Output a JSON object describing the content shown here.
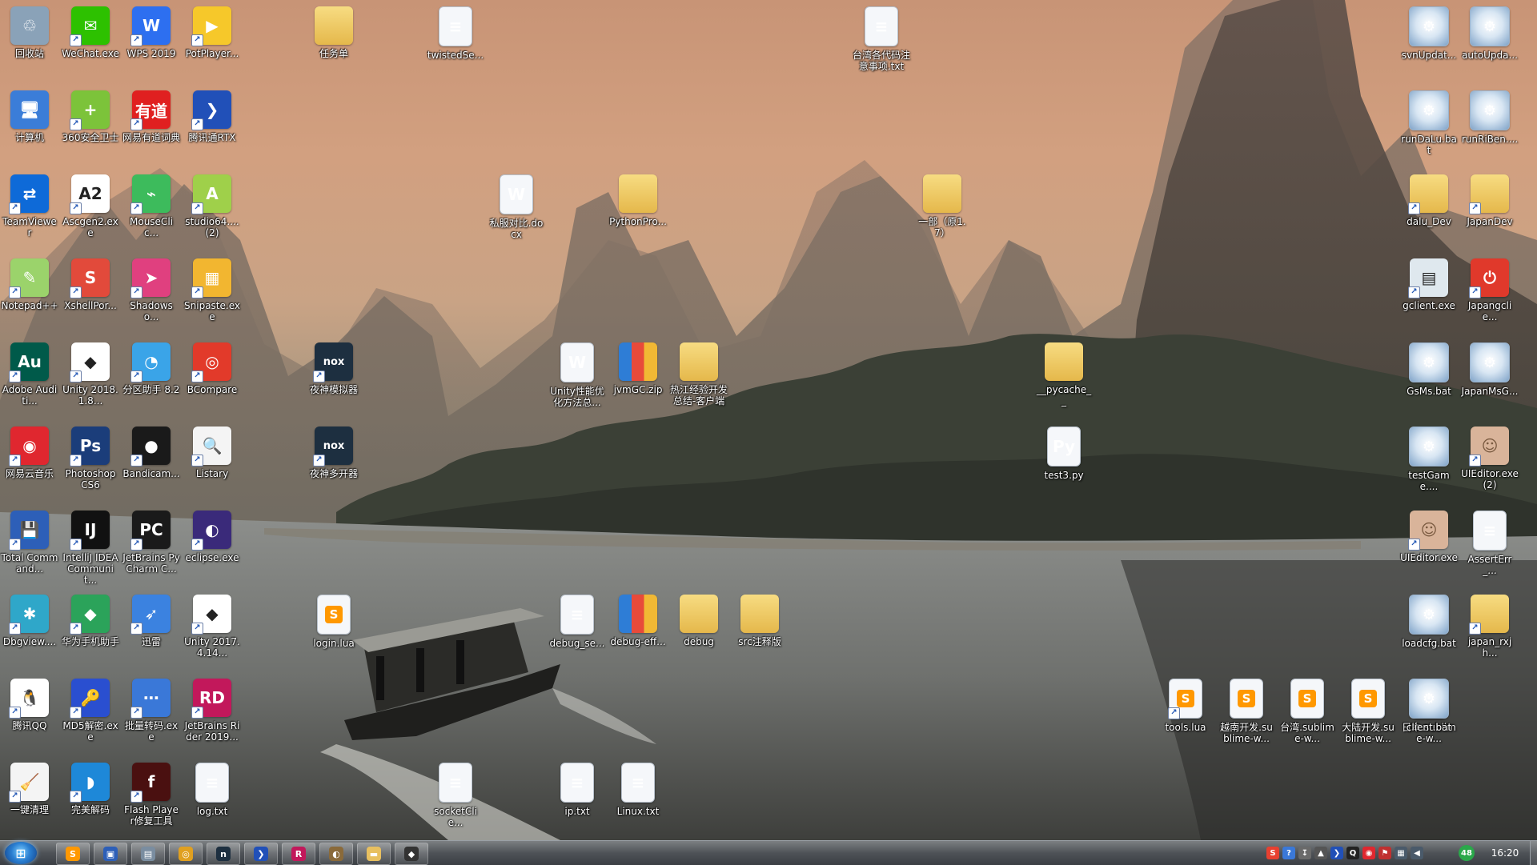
{
  "desktop": {
    "icons": [
      {
        "label": "回收站",
        "kind": "app",
        "color": "#8aa2b8",
        "glyph": "♲",
        "shortcut": false
      },
      {
        "label": "WeChat.exe",
        "kind": "app",
        "color": "#2dc100",
        "glyph": "✉",
        "shortcut": true
      },
      {
        "label": "WPS 2019",
        "kind": "app",
        "color": "#2d6ff0",
        "glyph": "W",
        "shortcut": true
      },
      {
        "label": "PotPlayer...",
        "kind": "app",
        "color": "#f6c82a",
        "glyph": "▶",
        "shortcut": true
      },
      {
        "label": "任务单",
        "kind": "folder",
        "color": "#f0cc6a",
        "glyph": "",
        "shortcut": false
      },
      {
        "label": "twistedSe...",
        "kind": "file",
        "color": "#ffffff",
        "glyph": "≡",
        "shortcut": false
      },
      {
        "label": "台湾各代码注意事项.txt",
        "kind": "file",
        "color": "#ffffff",
        "glyph": "≡",
        "shortcut": false
      },
      {
        "label": "svnUpdat...",
        "kind": "bat",
        "color": "#cfe0f0",
        "glyph": "⚙",
        "shortcut": false
      },
      {
        "label": "autoUpda...",
        "kind": "bat",
        "color": "#cfe0f0",
        "glyph": "⚙",
        "shortcut": false
      },
      {
        "label": "计算机",
        "kind": "app",
        "color": "#3b7dd8",
        "glyph": "🖥",
        "shortcut": false
      },
      {
        "label": "360安全卫士",
        "kind": "app",
        "color": "#7cc33a",
        "glyph": "+",
        "shortcut": true
      },
      {
        "label": "网易有道词典",
        "kind": "app",
        "color": "#e02020",
        "glyph": "有道",
        "shortcut": true
      },
      {
        "label": "腾讯通RTX",
        "kind": "app",
        "color": "#2150b8",
        "glyph": "❯",
        "shortcut": true
      },
      {
        "label": "runDaLu.bat",
        "kind": "bat",
        "color": "#cfe0f0",
        "glyph": "⚙",
        "shortcut": false
      },
      {
        "label": "runRiBen....",
        "kind": "bat",
        "color": "#cfe0f0",
        "glyph": "⚙",
        "shortcut": false
      },
      {
        "label": "TeamViewer",
        "kind": "app",
        "color": "#0e6ad8",
        "glyph": "⇄",
        "shortcut": true
      },
      {
        "label": "Ascgen2.exe",
        "kind": "app",
        "color": "#ffffff",
        "glyph": "A2",
        "shortcut": true
      },
      {
        "label": "MouseClic...",
        "kind": "app",
        "color": "#3dbb5c",
        "glyph": "⌁",
        "shortcut": true
      },
      {
        "label": "studio64.... (2)",
        "kind": "app",
        "color": "#9fd04a",
        "glyph": "A",
        "shortcut": true
      },
      {
        "label": "私服对比.docx",
        "kind": "file",
        "color": "#ffffff",
        "glyph": "W",
        "shortcut": false
      },
      {
        "label": "PythonPro...",
        "kind": "folder",
        "color": "#f0cc6a",
        "glyph": "",
        "shortcut": false
      },
      {
        "label": "一部（原1.7）",
        "kind": "folder",
        "color": "#f0cc6a",
        "glyph": "",
        "shortcut": false
      },
      {
        "label": "dalu_Dev",
        "kind": "folder",
        "color": "#f0cc6a",
        "glyph": "",
        "shortcut": true
      },
      {
        "label": "JapanDev",
        "kind": "folder",
        "color": "#f0cc6a",
        "glyph": "",
        "shortcut": true
      },
      {
        "label": "Notepad++",
        "kind": "app",
        "color": "#9bd36b",
        "glyph": "✎",
        "shortcut": true
      },
      {
        "label": "XshellPor...",
        "kind": "app",
        "color": "#e24a3b",
        "glyph": "S",
        "shortcut": true
      },
      {
        "label": "Shadowso...",
        "kind": "app",
        "color": "#e0407f",
        "glyph": "➤",
        "shortcut": true
      },
      {
        "label": "Snipaste.exe",
        "kind": "app",
        "color": "#f2b630",
        "glyph": "▦",
        "shortcut": true
      },
      {
        "label": "gclient.exe",
        "kind": "app",
        "color": "#dfe8ee",
        "glyph": "▤",
        "shortcut": true
      },
      {
        "label": "Japangclie...",
        "kind": "app",
        "color": "#e0392b",
        "glyph": "⏻",
        "shortcut": true
      },
      {
        "label": "Adobe Auditi...",
        "kind": "app",
        "color": "#005a4a",
        "glyph": "Au",
        "shortcut": true
      },
      {
        "label": "Unity 2018.1.8...",
        "kind": "app",
        "color": "#ffffff",
        "glyph": "◆",
        "shortcut": true
      },
      {
        "label": "分区助手 8.2",
        "kind": "app",
        "color": "#3aa4e8",
        "glyph": "◔",
        "shortcut": true
      },
      {
        "label": "BCompare",
        "kind": "app",
        "color": "#e23a2a",
        "glyph": "◎",
        "shortcut": true
      },
      {
        "label": "夜神模拟器",
        "kind": "app",
        "color": "#1d2f40",
        "glyph": "nox",
        "shortcut": true
      },
      {
        "label": "Unity性能优化方法总...",
        "kind": "file",
        "color": "#ffffff",
        "glyph": "W",
        "shortcut": false
      },
      {
        "label": "jvmGC.zip",
        "kind": "zip",
        "color": "#2e7dd6",
        "glyph": "",
        "shortcut": false
      },
      {
        "label": "热江经验开发总结-客户端",
        "kind": "folder",
        "color": "#f0cc6a",
        "glyph": "",
        "shortcut": false
      },
      {
        "label": "__pycache__",
        "kind": "folder",
        "color": "#f0cc6a",
        "glyph": "",
        "shortcut": false
      },
      {
        "label": "GsMs.bat",
        "kind": "bat",
        "color": "#cfe0f0",
        "glyph": "⚙",
        "shortcut": false
      },
      {
        "label": "JapanMsG...",
        "kind": "bat",
        "color": "#cfe0f0",
        "glyph": "⚙",
        "shortcut": false
      },
      {
        "label": "网易云音乐",
        "kind": "app",
        "color": "#e0272f",
        "glyph": "◉",
        "shortcut": true
      },
      {
        "label": "Photoshop CS6",
        "kind": "app",
        "color": "#1b3d7a",
        "glyph": "Ps",
        "shortcut": true
      },
      {
        "label": "Bandicam...",
        "kind": "app",
        "color": "#1a1a1a",
        "glyph": "●",
        "shortcut": true
      },
      {
        "label": "Listary",
        "kind": "app",
        "color": "#f4f4f4",
        "glyph": "🔍",
        "shortcut": true
      },
      {
        "label": "夜神多开器",
        "kind": "app",
        "color": "#1d2f40",
        "glyph": "nox",
        "shortcut": true
      },
      {
        "label": "test3.py",
        "kind": "file",
        "color": "#ffffff",
        "glyph": "Py",
        "shortcut": false
      },
      {
        "label": "testGame....",
        "kind": "bat",
        "color": "#cfe0f0",
        "glyph": "⚙",
        "shortcut": false
      },
      {
        "label": "UIEditor.exe (2)",
        "kind": "img",
        "color": "#d9b49a",
        "glyph": "☺",
        "shortcut": true
      },
      {
        "label": "Total Command...",
        "kind": "app",
        "color": "#2d5fb8",
        "glyph": "💾",
        "shortcut": true
      },
      {
        "label": "IntelliJ IDEA Communit...",
        "kind": "app",
        "color": "#111111",
        "glyph": "IJ",
        "shortcut": true
      },
      {
        "label": "JetBrains PyCharm C...",
        "kind": "app",
        "color": "#1a1a1a",
        "glyph": "PC",
        "shortcut": true
      },
      {
        "label": "eclipse.exe",
        "kind": "app",
        "color": "#3a2a7a",
        "glyph": "◐",
        "shortcut": true
      },
      {
        "label": "UIEditor.exe",
        "kind": "img",
        "color": "#d9b49a",
        "glyph": "☺",
        "shortcut": true
      },
      {
        "label": "AssertErr_...",
        "kind": "file",
        "color": "#ffffff",
        "glyph": "≡",
        "shortcut": false
      },
      {
        "label": "Dbgview....",
        "kind": "app",
        "color": "#2fa7c9",
        "glyph": "✱",
        "shortcut": true
      },
      {
        "label": "华为手机助手",
        "kind": "app",
        "color": "#2ba35a",
        "glyph": "◆",
        "shortcut": true
      },
      {
        "label": "迅雷",
        "kind": "app",
        "color": "#3b82e0",
        "glyph": "➶",
        "shortcut": true
      },
      {
        "label": "Unity 2017.4.14...",
        "kind": "app",
        "color": "#ffffff",
        "glyph": "◆",
        "shortcut": true
      },
      {
        "label": "login.lua",
        "kind": "sublime",
        "color": "#ffffff",
        "glyph": "S",
        "shortcut": false
      },
      {
        "label": "debug_se...",
        "kind": "file",
        "color": "#ffffff",
        "glyph": "≡",
        "shortcut": false
      },
      {
        "label": "debug-eff...",
        "kind": "zip",
        "color": "#2e7dd6",
        "glyph": "",
        "shortcut": false
      },
      {
        "label": "debug",
        "kind": "folder",
        "color": "#f0cc6a",
        "glyph": "",
        "shortcut": false
      },
      {
        "label": "src注释版",
        "kind": "folder",
        "color": "#f0cc6a",
        "glyph": "",
        "shortcut": false
      },
      {
        "label": "loadcfg.bat",
        "kind": "bat",
        "color": "#cfe0f0",
        "glyph": "⚙",
        "shortcut": false
      },
      {
        "label": "japan_rxjh...",
        "kind": "folder",
        "color": "#f0cc6a",
        "glyph": "",
        "shortcut": true
      },
      {
        "label": "腾讯QQ",
        "kind": "app",
        "color": "#ffffff",
        "glyph": "🐧",
        "shortcut": true
      },
      {
        "label": "MD5解密.exe",
        "kind": "app",
        "color": "#2a4fd0",
        "glyph": "🔑",
        "shortcut": true
      },
      {
        "label": "批量转码.exe",
        "kind": "app",
        "color": "#3a78d8",
        "glyph": "⋯",
        "shortcut": true
      },
      {
        "label": "JetBrains Rider 2019...",
        "kind": "app",
        "color": "#c2185b",
        "glyph": "RD",
        "shortcut": true
      },
      {
        "label": "tools.lua",
        "kind": "sublime",
        "color": "#ffffff",
        "glyph": "S",
        "shortcut": true
      },
      {
        "label": "越南开发.sublime-w...",
        "kind": "sublime",
        "color": "#ffffff",
        "glyph": "S",
        "shortcut": false
      },
      {
        "label": "台湾.sublime-w...",
        "kind": "sublime",
        "color": "#ffffff",
        "glyph": "S",
        "shortcut": false
      },
      {
        "label": "大陆开发.sublime-w...",
        "kind": "sublime",
        "color": "#ffffff",
        "glyph": "S",
        "shortcut": false
      },
      {
        "label": "日本.sublime-w...",
        "kind": "sublime",
        "color": "#ffffff",
        "glyph": "S",
        "shortcut": false
      },
      {
        "label": "client.bat",
        "kind": "bat",
        "color": "#cfe0f0",
        "glyph": "⚙",
        "shortcut": false
      },
      {
        "label": "一键清理",
        "kind": "app",
        "color": "#f4f4f4",
        "glyph": "🧹",
        "shortcut": true
      },
      {
        "label": "完美解码",
        "kind": "app",
        "color": "#1e88d8",
        "glyph": "◗",
        "shortcut": true
      },
      {
        "label": "Flash Player修复工具",
        "kind": "app",
        "color": "#4a1010",
        "glyph": "f",
        "shortcut": true
      },
      {
        "label": "log.txt",
        "kind": "file",
        "color": "#ffffff",
        "glyph": "≡",
        "shortcut": false
      },
      {
        "label": "socketClie...",
        "kind": "file",
        "color": "#ffffff",
        "glyph": "≡",
        "shortcut": false
      },
      {
        "label": "ip.txt",
        "kind": "file",
        "color": "#ffffff",
        "glyph": "≡",
        "shortcut": false
      },
      {
        "label": "Linux.txt",
        "kind": "file",
        "color": "#ffffff",
        "glyph": "≡",
        "shortcut": false
      }
    ]
  },
  "taskbar": {
    "start_glyph": "⊞",
    "pinned": [
      {
        "name": "sublime-text",
        "glyph": "S",
        "color": "#ff9800"
      },
      {
        "name": "save-disk",
        "glyph": "▣",
        "color": "#2d5fb8"
      },
      {
        "name": "window-app",
        "glyph": "▤",
        "color": "#7a8da0"
      },
      {
        "name": "chrome",
        "glyph": "◎",
        "color": "#e0a020"
      },
      {
        "name": "nox",
        "glyph": "n",
        "color": "#1d2f40"
      },
      {
        "name": "rtx",
        "glyph": "❯",
        "color": "#2150b8"
      },
      {
        "name": "rider",
        "glyph": "R",
        "color": "#c2185b"
      },
      {
        "name": "media",
        "glyph": "◐",
        "color": "#8a6a3a"
      },
      {
        "name": "explorer",
        "glyph": "▬",
        "color": "#e8c060"
      },
      {
        "name": "unity",
        "glyph": "◆",
        "color": "#333333"
      }
    ],
    "tray": [
      {
        "name": "sogou",
        "glyph": "S",
        "color": "#e84030"
      },
      {
        "name": "help",
        "glyph": "?",
        "color": "#3a78d8"
      },
      {
        "name": "usb",
        "glyph": "↧",
        "color": "#6a6a6a"
      },
      {
        "name": "expand",
        "glyph": "▲",
        "color": "#555555"
      },
      {
        "name": "rtx-tray",
        "glyph": "❯",
        "color": "#2150b8"
      },
      {
        "name": "qq",
        "glyph": "Q",
        "color": "#222222"
      },
      {
        "name": "netease-music",
        "glyph": "◉",
        "color": "#e0272f"
      },
      {
        "name": "flag",
        "glyph": "⚑",
        "color": "#c03030"
      },
      {
        "name": "network",
        "glyph": "▦",
        "color": "#4a5a6a"
      },
      {
        "name": "volume",
        "glyph": "◀",
        "color": "#4a5a6a"
      }
    ],
    "badge": "48",
    "clock": "16:20"
  }
}
